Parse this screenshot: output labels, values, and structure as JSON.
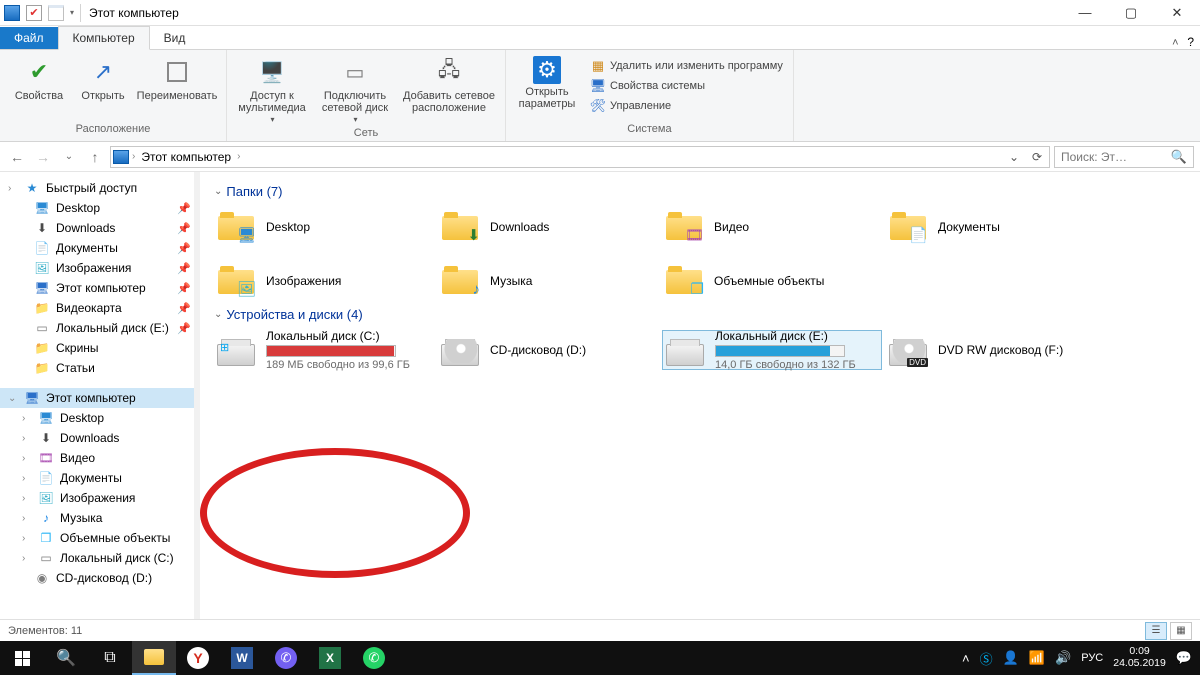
{
  "title": "Этот компьютер",
  "ribbonTabs": {
    "file": "Файл",
    "computer": "Компьютер",
    "view": "Вид"
  },
  "ribbon": {
    "location": {
      "properties": "Свойства",
      "open": "Открыть",
      "rename": "Переименовать",
      "group": "Расположение"
    },
    "network": {
      "media": "Доступ к мультимедиа",
      "map": "Подключить сетевой диск",
      "addloc": "Добавить сетевое расположение",
      "group": "Сеть"
    },
    "system": {
      "settings": "Открыть параметры",
      "uninstall": "Удалить или изменить программу",
      "sysprops": "Свойства системы",
      "manage": "Управление",
      "group": "Система"
    }
  },
  "breadcrumb": {
    "root": "Этот компьютер"
  },
  "search_placeholder": "Поиск: Эт…",
  "nav": {
    "quick": "Быстрый доступ",
    "desktop": "Desktop",
    "downloads": "Downloads",
    "documents": "Документы",
    "images": "Изображения",
    "thispc": "Этот компьютер",
    "videocard": "Видеокарта",
    "localE": "Локальный диск (E:)",
    "screens": "Скрины",
    "articles": "Статьи",
    "thispc2": "Этот компьютер",
    "desktop2": "Desktop",
    "downloads2": "Downloads",
    "video": "Видео",
    "documents2": "Документы",
    "images2": "Изображения",
    "music": "Музыка",
    "objects3d": "Объемные объекты",
    "localC": "Локальный диск (C:)",
    "cdD": "CD-дисковод (D:)"
  },
  "sections": {
    "folders": "Папки (7)",
    "drives": "Устройства и диски (4)"
  },
  "folders": {
    "desktop": "Desktop",
    "downloads": "Downloads",
    "video": "Видео",
    "documents": "Документы",
    "images": "Изображения",
    "music": "Музыка",
    "objects3d": "Объемные объекты"
  },
  "drives": {
    "c": {
      "name": "Локальный диск (C:)",
      "sub": "189 МБ свободно из 99,6 ГБ",
      "fill_pct": 99,
      "fill_color": "#d83b3b"
    },
    "d": {
      "name": "CD-дисковод (D:)"
    },
    "e": {
      "name": "Локальный диск (E:)",
      "sub": "14,0 ГБ свободно из 132 ГБ",
      "fill_pct": 89,
      "fill_color": "#26a0da"
    },
    "f": {
      "name": "DVD RW дисковод (F:)"
    }
  },
  "status": {
    "items": "Элементов: 11"
  },
  "tray": {
    "lang": "РУС",
    "time": "0:09",
    "date": "24.05.2019"
  }
}
